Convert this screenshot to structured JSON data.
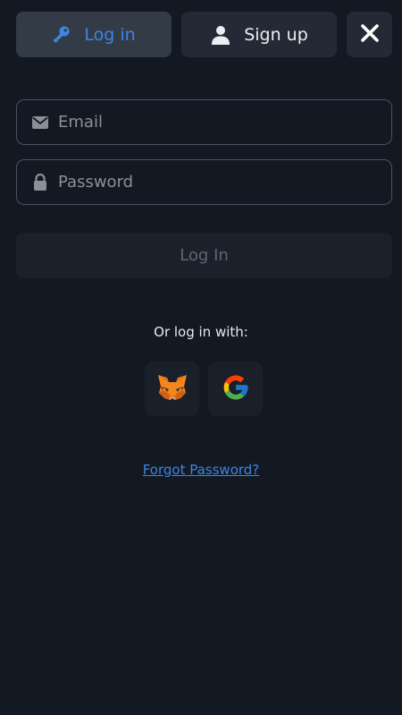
{
  "tabs": {
    "login_label": "Log in",
    "signup_label": "Sign up",
    "active": "login"
  },
  "form": {
    "email_placeholder": "Email",
    "email_value": "",
    "password_placeholder": "Password",
    "password_value": "",
    "submit_label": "Log In"
  },
  "social": {
    "heading": "Or log in with:",
    "providers": [
      {
        "name": "MetaMask",
        "icon": "metamask-fox-icon"
      },
      {
        "name": "Google",
        "icon": "google-g-icon"
      }
    ]
  },
  "links": {
    "forgot_password": "Forgot Password?"
  },
  "colors": {
    "background": "#131922",
    "accent": "#3d85e6",
    "tab_active_bg": "#333b47",
    "tab_inactive_bg": "#232a35",
    "field_border": "#4a5260",
    "button_disabled_bg": "#1b212b",
    "button_disabled_text": "#5f6671"
  }
}
